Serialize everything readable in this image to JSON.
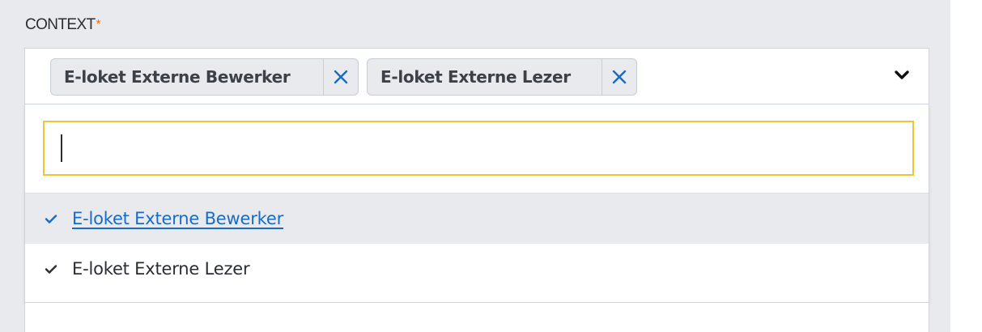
{
  "field": {
    "label": "CONTEXT",
    "required_mark": "*"
  },
  "select": {
    "selected_tags": [
      {
        "label": "E-loket Externe Bewerker",
        "remove_icon": "close-icon"
      },
      {
        "label": "E-loket Externe Lezer",
        "remove_icon": "close-icon"
      }
    ],
    "toggle_icon": "chevron-down-icon"
  },
  "dropdown": {
    "search": {
      "value": "",
      "placeholder": ""
    },
    "options": [
      {
        "label": "E-loket Externe Bewerker",
        "selected": true,
        "highlighted": true,
        "icon": "check-icon"
      },
      {
        "label": "E-loket Externe Lezer",
        "selected": true,
        "highlighted": false,
        "icon": "check-icon"
      }
    ]
  },
  "colors": {
    "panel_bg": "#e8eaee",
    "required": "#e6731a",
    "accent_blue": "#1a6bc4",
    "focus_border": "#f2c530",
    "text": "#2a2d33"
  }
}
